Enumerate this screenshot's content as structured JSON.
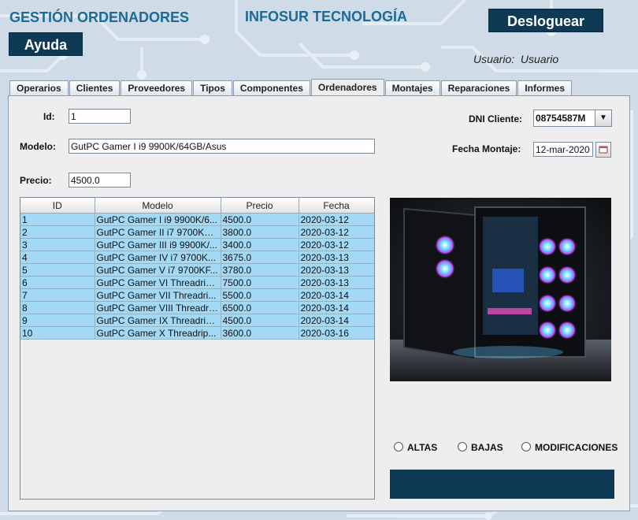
{
  "header": {
    "app_title": "GESTIÓN ORDENADORES",
    "company": "INFOSUR TECNOLOGÍA",
    "logout_label": "Desloguear",
    "help_label": "Ayuda",
    "user_label": "Usuario:",
    "user_value": "Usuario"
  },
  "tabs": [
    {
      "label": "Operarios"
    },
    {
      "label": "Clientes"
    },
    {
      "label": "Proveedores"
    },
    {
      "label": "Tipos"
    },
    {
      "label": "Componentes"
    },
    {
      "label": "Ordenadores"
    },
    {
      "label": "Montajes"
    },
    {
      "label": "Reparaciones"
    },
    {
      "label": "Informes"
    }
  ],
  "active_tab": "Ordenadores",
  "form": {
    "id_label": "Id:",
    "id_value": "1",
    "modelo_label": "Modelo:",
    "modelo_value": "GutPC Gamer I i9 9900K/64GB/Asus",
    "precio_label": "Precio:",
    "precio_value": "4500.0",
    "dni_label": "DNI Cliente:",
    "dni_value": "08754587M",
    "fecha_label": "Fecha Montaje:",
    "fecha_value": "12-mar-2020"
  },
  "table": {
    "headers": [
      "ID",
      "Modelo",
      "Precio",
      "Fecha"
    ],
    "rows": [
      [
        "1",
        "GutPC Gamer I i9 9900K/6...",
        "4500.0",
        "2020-03-12"
      ],
      [
        "2",
        "GutPC Gamer II i7 9700KF/...",
        "3800.0",
        "2020-03-12"
      ],
      [
        "3",
        "GutPC Gamer III i9 9900K/...",
        "3400.0",
        "2020-03-12"
      ],
      [
        "4",
        "GutPC Gamer IV i7 9700K...",
        "3675.0",
        "2020-03-13"
      ],
      [
        "5",
        "GutPC Gamer V i7 9700KF...",
        "3780.0",
        "2020-03-13"
      ],
      [
        "6",
        "GutPC Gamer VI Threadrip...",
        "7500.0",
        "2020-03-13"
      ],
      [
        "7",
        "GutPC Gamer VII Threadri...",
        "5500.0",
        "2020-03-14"
      ],
      [
        "8",
        "GutPC Gamer VIII Threadri...",
        "6500.0",
        "2020-03-14"
      ],
      [
        "9",
        "GutPC Gamer IX Threadrip...",
        "4500.0",
        "2020-03-14"
      ],
      [
        "10",
        "GutPC Gamer X Threadrip...",
        "3600.0",
        "2020-03-16"
      ]
    ]
  },
  "options": {
    "altas": "ALTAS",
    "bajas": "BAJAS",
    "modificaciones": "MODIFICACIONES"
  },
  "colors": {
    "brand_dark": "#0f3a56",
    "title_blue": "#1d6a96",
    "row_highlight": "#a3d9f5"
  }
}
